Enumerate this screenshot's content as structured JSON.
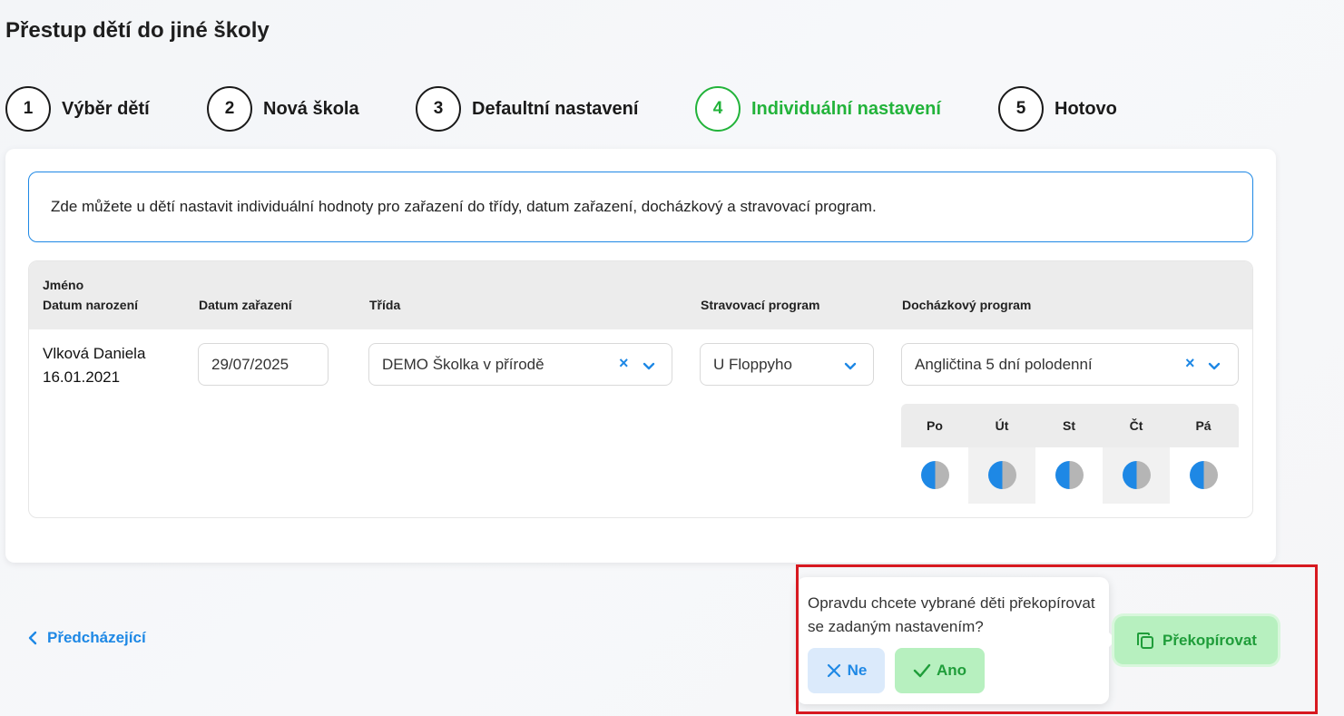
{
  "page": {
    "title": "Přestup dětí do jiné školy"
  },
  "stepper": [
    {
      "number": "1",
      "label": "Výběr dětí",
      "active": false
    },
    {
      "number": "2",
      "label": "Nová škola",
      "active": false
    },
    {
      "number": "3",
      "label": "Defaultní nastavení",
      "active": false
    },
    {
      "number": "4",
      "label": "Individuální nastavení",
      "active": true
    },
    {
      "number": "5",
      "label": "Hotovo",
      "active": false
    }
  ],
  "info": {
    "text": "Zde můžete u dětí nastavit individuální hodnoty pro zařazení do třídy, datum zařazení, docházkový a stravovací program."
  },
  "table": {
    "headers": {
      "name_line1": "Jméno",
      "name_line2": "Datum narození",
      "enrollment_date": "Datum zařazení",
      "class": "Třída",
      "meal_program": "Stravovací program",
      "attendance_program": "Docházkový program"
    },
    "rows": [
      {
        "name": "Vlková Daniela",
        "birth_date": "16.01.2021",
        "enrollment_date": "29/07/2025",
        "class": "DEMO Školka v přírodě",
        "meal_program": "U Floppyho",
        "attendance_program": "Angličtina 5 dní polodenní",
        "days": [
          "Po",
          "Út",
          "St",
          "Čt",
          "Pá"
        ],
        "day_state": "half"
      }
    ]
  },
  "nav": {
    "previous_label": "Předcházející"
  },
  "confirm": {
    "text": "Opravdu chcete vybrané děti překopírovat se zadaným nastavením?",
    "no_label": "Ne",
    "yes_label": "Ano"
  },
  "actions": {
    "copy_label": "Překopírovat"
  },
  "colors": {
    "accent_blue": "#1e88e5",
    "accent_green": "#22b33a",
    "highlight_red": "#d71920"
  }
}
